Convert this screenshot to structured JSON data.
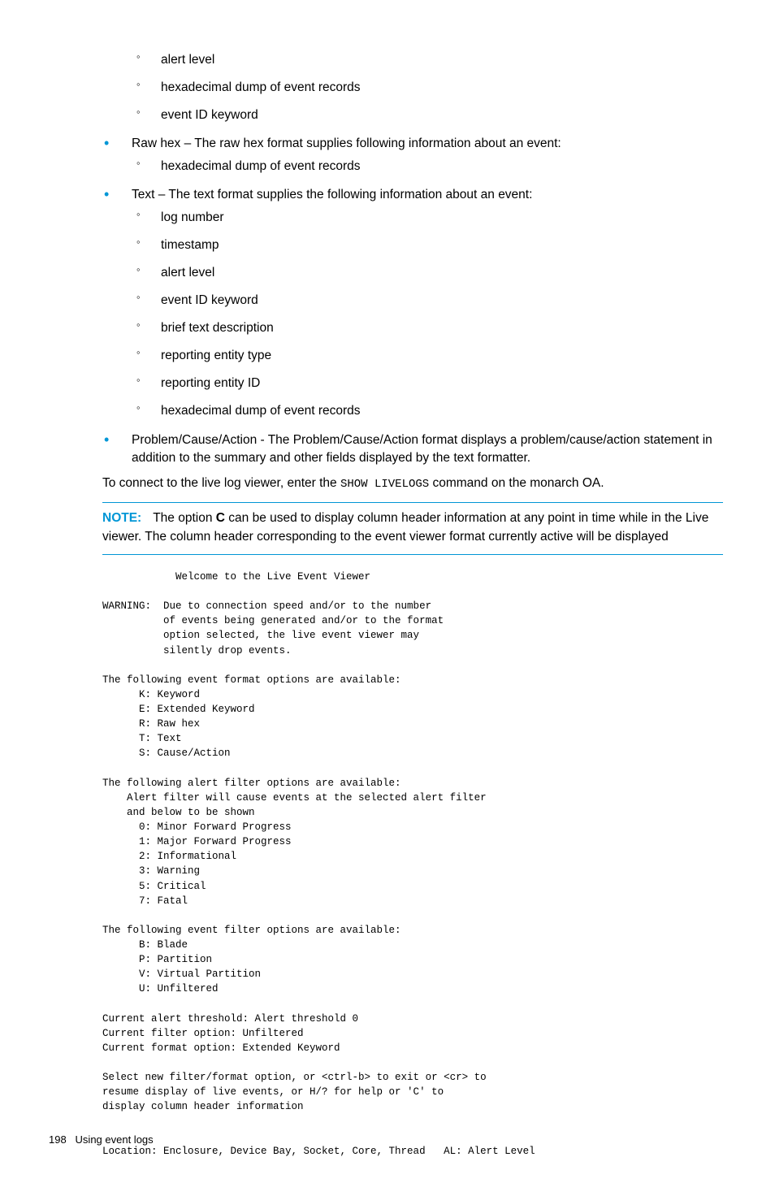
{
  "list1": {
    "sub_items": [
      "alert level",
      "hexadecimal dump of event records",
      "event ID keyword"
    ],
    "rawhex": {
      "text": "Raw hex – The raw hex format supplies following information about an event:",
      "sub": [
        "hexadecimal dump of event records"
      ]
    },
    "text": {
      "text": "Text – The text format supplies the following information about an event:",
      "sub": [
        "log number",
        "timestamp",
        "alert level",
        "event ID keyword",
        "brief text description",
        "reporting entity type",
        "reporting entity ID",
        "hexadecimal dump of event records"
      ]
    },
    "pca": "Problem/Cause/Action - The Problem/Cause/Action format displays a problem/cause/action statement in addition to the summary and other fields displayed by the text formatter."
  },
  "connect_para_pre": "To connect to the live log viewer, enter the ",
  "connect_cmd": "SHOW LIVELOGS",
  "connect_para_post": " command on the monarch OA.",
  "note": {
    "label": "NOTE:",
    "pre": "The option ",
    "bold": "C",
    "post": " can be used to display column header information at any point in time while in the Live viewer. The column header corresponding to the event viewer format currently active will be displayed"
  },
  "code": "            Welcome to the Live Event Viewer\n\nWARNING:  Due to connection speed and/or to the number\n          of events being generated and/or to the format\n          option selected, the live event viewer may\n          silently drop events.\n\nThe following event format options are available:\n      K: Keyword\n      E: Extended Keyword\n      R: Raw hex\n      T: Text\n      S: Cause/Action\n\nThe following alert filter options are available:\n    Alert filter will cause events at the selected alert filter \n    and below to be shown\n      0: Minor Forward Progress\n      1: Major Forward Progress\n      2: Informational\n      3: Warning\n      5: Critical\n      7: Fatal\n\nThe following event filter options are available:\n      B: Blade\n      P: Partition\n      V: Virtual Partition\n      U: Unfiltered\n\nCurrent alert threshold: Alert threshold 0\nCurrent filter option: Unfiltered\nCurrent format option: Extended Keyword\n\nSelect new filter/format option, or <ctrl-b> to exit or <cr> to\nresume display of live events, or H/? for help or 'C' to\ndisplay column header information\n\n\nLocation: Enclosure, Device Bay, Socket, Core, Thread   AL: Alert Level",
  "footer": {
    "page_num": "198",
    "section": "Using event logs"
  }
}
